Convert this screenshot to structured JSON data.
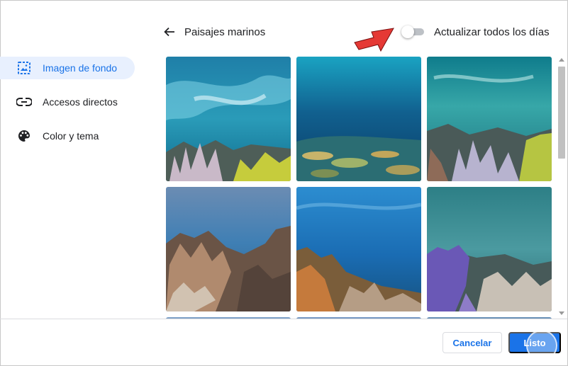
{
  "header": {
    "title": "Paisajes marinos",
    "toggle_label": "Actualizar todos los días",
    "toggle_on": false
  },
  "sidebar": {
    "items": [
      {
        "label": "Imagen de fondo",
        "icon": "image-icon",
        "active": true
      },
      {
        "label": "Accesos directos",
        "icon": "link-icon",
        "active": false
      },
      {
        "label": "Color y tema",
        "icon": "palette-icon",
        "active": false
      }
    ]
  },
  "gallery": {
    "tiles": [
      {
        "scene": "waves-coral"
      },
      {
        "scene": "deep-reef"
      },
      {
        "scene": "coral-garden"
      },
      {
        "scene": "rock-reef"
      },
      {
        "scene": "blue-reef"
      },
      {
        "scene": "purple-coral"
      }
    ]
  },
  "footer": {
    "cancel_label": "Cancelar",
    "done_label": "Listo"
  },
  "colors": {
    "accent": "#1a73e8",
    "active_bg": "#e8f0fe",
    "annotation_arrow": "#e53935"
  }
}
